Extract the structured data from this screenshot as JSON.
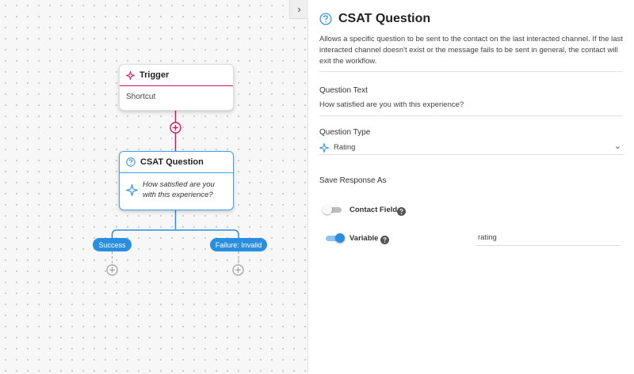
{
  "canvas": {
    "collapse_icon": "chevron-right-icon",
    "trigger_node": {
      "title": "Trigger",
      "icon": "sparkle-icon",
      "body": "Shortcut",
      "accent": "#d0175e"
    },
    "csat_node": {
      "title": "CSAT Question",
      "icon": "question-circle-icon",
      "question": "How satisfied are you with this experience?",
      "accent": "#3ea1e6"
    },
    "branches": [
      {
        "label": "Success"
      },
      {
        "label": "Failure: Invalid"
      }
    ]
  },
  "panel": {
    "title": "CSAT Question",
    "title_icon": "question-circle-icon",
    "description": "Allows a specific question to be sent to the contact on the last interacted channel. If the last interacted channel doesn't exist or the message fails to be sent in general, the contact will exit the workflow.",
    "question_text": {
      "label": "Question Text",
      "value": "How satisfied are you with this experience?"
    },
    "question_type": {
      "label": "Question Type",
      "value": "Rating",
      "icon": "sparkle-icon"
    },
    "save_response": {
      "label": "Save Response As",
      "contact_field": {
        "label": "Contact Field",
        "enabled": false
      },
      "variable": {
        "label": "Variable",
        "enabled": true,
        "value": "rating"
      }
    }
  },
  "colors": {
    "primary": "#2a8ee0",
    "trigger_accent": "#d0175e"
  }
}
